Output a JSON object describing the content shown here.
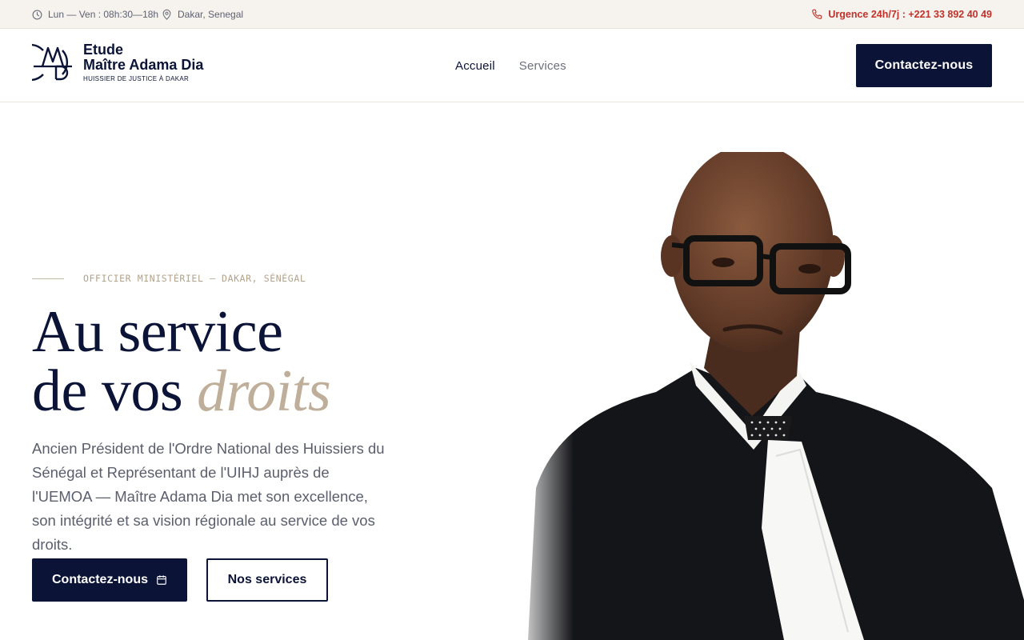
{
  "topbar": {
    "hours": "Lun — Ven : 08h:30—18h",
    "location": "Dakar, Senegal",
    "urgent": "Urgence 24h/7j : +221 33 892 40 49"
  },
  "brand": {
    "line1": "Etude",
    "line2": "Maître Adama Dia",
    "tagline": "HUISSIER DE JUSTICE À DAKAR"
  },
  "nav": {
    "items": [
      {
        "label": "Accueil",
        "active": true
      },
      {
        "label": "Services",
        "active": false
      }
    ],
    "cta": "Contactez-nous"
  },
  "hero": {
    "eyebrow": "OFFICIER MINISTÉRIEL — DAKAR, SÉNÉGAL",
    "title_line1": "Au service",
    "title_line2": "de vos",
    "title_accent": "droits",
    "lead": "Ancien Président de l'Ordre National des Huissiers du Sénégal et Représentant de l'UIHJ auprès de l'UEMOA — Maître Adama Dia met son excellence, son intégrité et sa vision régionale au service de vos droits.",
    "btn_primary": "Contactez-nous",
    "btn_secondary": "Nos services"
  },
  "colors": {
    "navy": "#0b1437",
    "accent_beige": "#bfae99",
    "urgent_red": "#c0322b",
    "topbar_bg": "#f6f3ee"
  },
  "icons": {
    "hours": "clock-icon",
    "location": "map-pin-icon",
    "urgent": "phone-icon",
    "cta": "calendar-icon"
  }
}
